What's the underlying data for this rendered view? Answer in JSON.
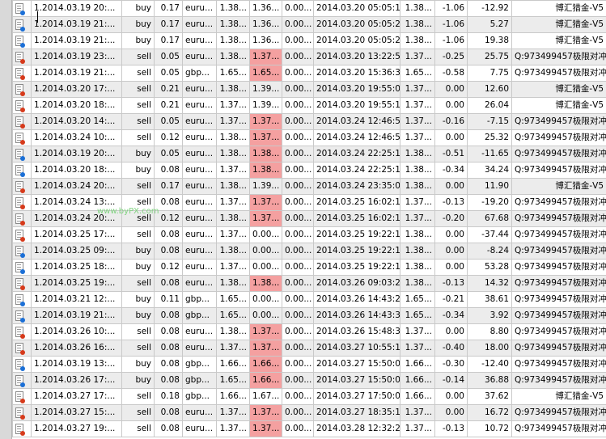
{
  "colors": {
    "row_alt_bg": "#ececec",
    "highlight_cell": "#f4a0a0",
    "buy_dot": "#1b6fd6",
    "sell_dot": "#d63a1b",
    "watermark": "#7fd37f"
  },
  "watermark": "www.byPX.com",
  "rows": [
    {
      "open_time": "1.2014.03.19 20:...",
      "type": "buy",
      "size": "0.17",
      "symbol": "euru...",
      "open_price": "1.38...",
      "sl": "1.36...",
      "tp": "0.00...",
      "close_time": "2014.03.20 05:05:12",
      "close_price": "1.38...",
      "swap": "-1.06",
      "profit": "-12.92",
      "comment": "博汇猎金-V5"
    },
    {
      "open_time": "1.2014.03.19 21:...",
      "type": "buy",
      "size": "0.17",
      "symbol": "euru...",
      "open_price": "1.38...",
      "sl": "1.36...",
      "tp": "0.00...",
      "close_time": "2014.03.20 05:05:20",
      "close_price": "1.38...",
      "swap": "-1.06",
      "profit": "5.27",
      "comment": "博汇猎金-V5"
    },
    {
      "open_time": "1.2014.03.19 21:...",
      "type": "buy",
      "size": "0.17",
      "symbol": "euru...",
      "open_price": "1.38...",
      "sl": "1.36...",
      "tp": "0.00...",
      "close_time": "2014.03.20 05:05:28",
      "close_price": "1.38...",
      "swap": "-1.06",
      "profit": "19.38",
      "comment": "博汇猎金-V5"
    },
    {
      "open_time": "1.2014.03.19 23:...",
      "type": "sell",
      "size": "0.05",
      "symbol": "euru...",
      "open_price": "1.38...",
      "sl": "1.37...",
      "tp": "0.00...",
      "close_time": "2014.03.20 13:22:55",
      "close_price": "1.37...",
      "swap": "-0.25",
      "profit": "25.75",
      "comment": "Q:973499457极限对冲"
    },
    {
      "open_time": "1.2014.03.19 21:...",
      "type": "sell",
      "size": "0.05",
      "symbol": "gbp...",
      "open_price": "1.65...",
      "sl": "1.65...",
      "tp": "0.00...",
      "close_time": "2014.03.20 15:36:33",
      "close_price": "1.65...",
      "swap": "-0.58",
      "profit": "7.75",
      "comment": "Q:973499457极限对冲"
    },
    {
      "open_time": "1.2014.03.20 17:...",
      "type": "sell",
      "size": "0.21",
      "symbol": "euru...",
      "open_price": "1.38...",
      "sl": "1.39...",
      "tp": "0.00...",
      "close_time": "2014.03.20 19:55:04",
      "close_price": "1.37...",
      "swap": "0.00",
      "profit": "12.60",
      "comment": "博汇猎金-V5"
    },
    {
      "open_time": "1.2014.03.20 18:...",
      "type": "sell",
      "size": "0.21",
      "symbol": "euru...",
      "open_price": "1.37...",
      "sl": "1.39...",
      "tp": "0.00...",
      "close_time": "2014.03.20 19:55:12",
      "close_price": "1.37...",
      "swap": "0.00",
      "profit": "26.04",
      "comment": "博汇猎金-V5"
    },
    {
      "open_time": "1.2014.03.20 14:...",
      "type": "sell",
      "size": "0.05",
      "symbol": "euru...",
      "open_price": "1.37...",
      "sl": "1.37...",
      "tp": "0.00...",
      "close_time": "2014.03.24 12:46:58",
      "close_price": "1.37...",
      "swap": "-0.16",
      "profit": "-7.15",
      "comment": "Q:973499457极限对冲"
    },
    {
      "open_time": "1.2014.03.24 10:...",
      "type": "sell",
      "size": "0.12",
      "symbol": "euru...",
      "open_price": "1.38...",
      "sl": "1.37...",
      "tp": "0.00...",
      "close_time": "2014.03.24 12:46:58",
      "close_price": "1.37...",
      "swap": "0.00",
      "profit": "25.32",
      "comment": "Q:973499457极限对冲"
    },
    {
      "open_time": "1.2014.03.19 20:...",
      "type": "buy",
      "size": "0.05",
      "symbol": "euru...",
      "open_price": "1.38...",
      "sl": "1.38...",
      "tp": "0.00...",
      "close_time": "2014.03.24 22:25:11",
      "close_price": "1.38...",
      "swap": "-0.51",
      "profit": "-11.65",
      "comment": "Q:973499457极限对冲"
    },
    {
      "open_time": "1.2014.03.20 18:...",
      "type": "buy",
      "size": "0.08",
      "symbol": "euru...",
      "open_price": "1.37...",
      "sl": "1.38...",
      "tp": "0.00...",
      "close_time": "2014.03.24 22:25:11",
      "close_price": "1.38...",
      "swap": "-0.34",
      "profit": "34.24",
      "comment": "Q:973499457极限对冲"
    },
    {
      "open_time": "1.2014.03.24 20:...",
      "type": "sell",
      "size": "0.17",
      "symbol": "euru...",
      "open_price": "1.38...",
      "sl": "1.39...",
      "tp": "0.00...",
      "close_time": "2014.03.24 23:35:09",
      "close_price": "1.38...",
      "swap": "0.00",
      "profit": "11.90",
      "comment": "博汇猎金-V5"
    },
    {
      "open_time": "1.2014.03.24 13:...",
      "type": "sell",
      "size": "0.08",
      "symbol": "euru...",
      "open_price": "1.37...",
      "sl": "1.37...",
      "tp": "0.00...",
      "close_time": "2014.03.25 16:02:18",
      "close_price": "1.37...",
      "swap": "-0.13",
      "profit": "-19.20",
      "comment": "Q:973499457极限对冲"
    },
    {
      "open_time": "1.2014.03.24 20:...",
      "type": "sell",
      "size": "0.12",
      "symbol": "euru...",
      "open_price": "1.38...",
      "sl": "1.37...",
      "tp": "0.00...",
      "close_time": "2014.03.25 16:02:18",
      "close_price": "1.37...",
      "swap": "-0.20",
      "profit": "67.68",
      "comment": "Q:973499457极限对冲"
    },
    {
      "open_time": "1.2014.03.25 17:...",
      "type": "sell",
      "size": "0.08",
      "symbol": "euru...",
      "open_price": "1.37...",
      "sl": "0.00...",
      "tp": "0.00...",
      "close_time": "2014.03.25 19:22:12",
      "close_price": "1.38...",
      "swap": "0.00",
      "profit": "-37.44",
      "comment": "Q:973499457极限对冲"
    },
    {
      "open_time": "1.2014.03.25 09:...",
      "type": "buy",
      "size": "0.08",
      "symbol": "euru...",
      "open_price": "1.38...",
      "sl": "0.00...",
      "tp": "0.00...",
      "close_time": "2014.03.25 19:22:14",
      "close_price": "1.38...",
      "swap": "0.00",
      "profit": "-8.24",
      "comment": "Q:973499457极限对冲"
    },
    {
      "open_time": "1.2014.03.25 18:...",
      "type": "buy",
      "size": "0.12",
      "symbol": "euru...",
      "open_price": "1.37...",
      "sl": "0.00...",
      "tp": "0.00...",
      "close_time": "2014.03.25 19:22:17",
      "close_price": "1.38...",
      "swap": "0.00",
      "profit": "53.28",
      "comment": "Q:973499457极限对冲"
    },
    {
      "open_time": "1.2014.03.25 19:...",
      "type": "sell",
      "size": "0.08",
      "symbol": "euru...",
      "open_price": "1.38...",
      "sl": "1.38...",
      "tp": "0.00...",
      "close_time": "2014.03.26 09:03:29",
      "close_price": "1.38...",
      "swap": "-0.13",
      "profit": "14.32",
      "comment": "Q:973499457极限对冲"
    },
    {
      "open_time": "1.2014.03.21 12:...",
      "type": "buy",
      "size": "0.11",
      "symbol": "gbp...",
      "open_price": "1.65...",
      "sl": "0.00...",
      "tp": "0.00...",
      "close_time": "2014.03.26 14:43:29",
      "close_price": "1.65...",
      "swap": "-0.21",
      "profit": "38.61",
      "comment": "Q:973499457极限对冲"
    },
    {
      "open_time": "1.2014.03.19 21:...",
      "type": "buy",
      "size": "0.08",
      "symbol": "gbp...",
      "open_price": "1.65...",
      "sl": "0.00...",
      "tp": "0.00...",
      "close_time": "2014.03.26 14:43:30",
      "close_price": "1.65...",
      "swap": "-0.34",
      "profit": "3.92",
      "comment": "Q:973499457极限对冲"
    },
    {
      "open_time": "1.2014.03.26 10:...",
      "type": "sell",
      "size": "0.08",
      "symbol": "euru...",
      "open_price": "1.38...",
      "sl": "1.37...",
      "tp": "0.00...",
      "close_time": "2014.03.26 15:48:36",
      "close_price": "1.37...",
      "swap": "0.00",
      "profit": "8.80",
      "comment": "Q:973499457极限对冲"
    },
    {
      "open_time": "1.2014.03.26 16:...",
      "type": "sell",
      "size": "0.08",
      "symbol": "euru...",
      "open_price": "1.37...",
      "sl": "1.37...",
      "tp": "0.00...",
      "close_time": "2014.03.27 10:55:13",
      "close_price": "1.37...",
      "swap": "-0.40",
      "profit": "18.00",
      "comment": "Q:973499457极限对冲"
    },
    {
      "open_time": "1.2014.03.19 13:...",
      "type": "buy",
      "size": "0.08",
      "symbol": "gbp...",
      "open_price": "1.66...",
      "sl": "1.66...",
      "tp": "0.00...",
      "close_time": "2014.03.27 15:50:05",
      "close_price": "1.66...",
      "swap": "-0.30",
      "profit": "-12.40",
      "comment": "Q:973499457极限对冲"
    },
    {
      "open_time": "1.2014.03.26 17:...",
      "type": "buy",
      "size": "0.08",
      "symbol": "gbp...",
      "open_price": "1.65...",
      "sl": "1.66...",
      "tp": "0.00...",
      "close_time": "2014.03.27 15:50:05",
      "close_price": "1.66...",
      "swap": "-0.14",
      "profit": "36.88",
      "comment": "Q:973499457极限对冲"
    },
    {
      "open_time": "1.2014.03.27 17:...",
      "type": "sell",
      "size": "0.18",
      "symbol": "gbp...",
      "open_price": "1.66...",
      "sl": "1.67...",
      "tp": "0.00...",
      "close_time": "2014.03.27 17:50:02",
      "close_price": "1.66...",
      "swap": "0.00",
      "profit": "37.62",
      "comment": "博汇猎金-V5"
    },
    {
      "open_time": "1.2014.03.27 15:...",
      "type": "sell",
      "size": "0.08",
      "symbol": "euru...",
      "open_price": "1.37...",
      "sl": "1.37...",
      "tp": "0.00...",
      "close_time": "2014.03.27 18:35:19",
      "close_price": "1.37...",
      "swap": "0.00",
      "profit": "16.72",
      "comment": "Q:973499457极限对冲"
    },
    {
      "open_time": "1.2014.03.27 19:...",
      "type": "sell",
      "size": "0.08",
      "symbol": "euru...",
      "open_price": "1.37...",
      "sl": "1.37...",
      "tp": "0.00...",
      "close_time": "2014.03.28 12:32:26",
      "close_price": "1.37...",
      "swap": "-0.13",
      "profit": "10.72",
      "comment": "Q:973499457极限对冲"
    }
  ]
}
